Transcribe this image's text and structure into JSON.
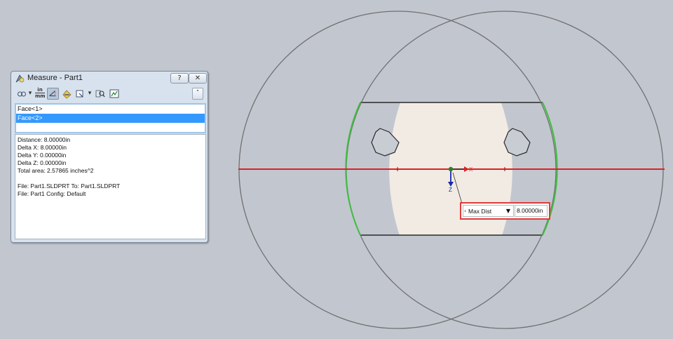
{
  "dialog": {
    "title": "Measure - Part1",
    "help_glyph": "?",
    "close_glyph": "✕",
    "toolbar": {
      "arc_icon": "arc-circle-icon",
      "units_top": "in",
      "units_bottom": "mm",
      "collapse_glyph": "˄"
    },
    "selections": [
      "Face<1>",
      "Face<2>"
    ],
    "selected_index": 1,
    "results": [
      "Distance: 8.00000in",
      "Delta X: 8.00000in",
      "Delta Y: 0.00000in",
      "Delta Z: 0.00000in",
      "Total area: 2.57865 inches^2"
    ],
    "files": [
      "File: Part1.SLDPRT To: Part1.SLDPRT",
      "File: Part1 Config: Default"
    ]
  },
  "graphics": {
    "axis_x_label": "X",
    "axis_z_label": "Z",
    "callout": {
      "label": "Max Dist",
      "value": "8.00000in",
      "drop_glyph": "▼",
      "left_glyph": "‹"
    }
  },
  "colors": {
    "background": "#c2c6cf",
    "part_fill": "#f1ebe4",
    "selected_edge": "#3fbf3f",
    "measure_line": "#e02020",
    "callout_border": "#e23a3a",
    "selection_highlight": "#3399ff"
  }
}
